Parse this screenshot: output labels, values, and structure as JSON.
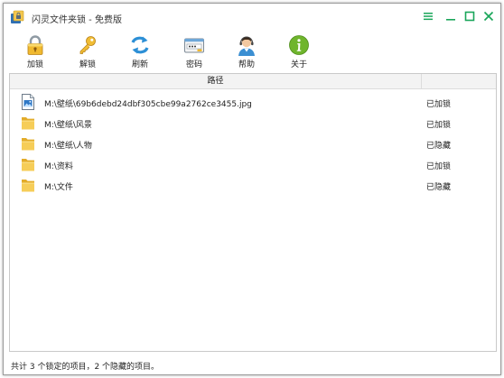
{
  "window": {
    "title": "闪灵文件夹锁 - 免费版",
    "colors": {
      "accent": "#1aa65a",
      "folder": "#f3c74e",
      "border": "#9a9a9a"
    }
  },
  "toolbar": {
    "items": [
      {
        "label": "加锁",
        "icon": "lock-icon"
      },
      {
        "label": "解锁",
        "icon": "key-icon"
      },
      {
        "label": "刷新",
        "icon": "refresh-icon"
      },
      {
        "label": "密码",
        "icon": "password-icon"
      },
      {
        "label": "帮助",
        "icon": "support-agent-icon"
      },
      {
        "label": "关于",
        "icon": "info-icon"
      }
    ]
  },
  "list": {
    "columns": {
      "path": "路径",
      "status": ""
    },
    "rows": [
      {
        "path": "M:\\壁纸\\69b6debd24dbf305cbe99a2762ce3455.jpg",
        "status": "已加锁",
        "icon": "image-file-icon"
      },
      {
        "path": "M:\\壁纸\\风景",
        "status": "已加锁",
        "icon": "folder-icon"
      },
      {
        "path": "M:\\壁纸\\人物",
        "status": "已隐藏",
        "icon": "folder-icon"
      },
      {
        "path": "M:\\资料",
        "status": "已加锁",
        "icon": "folder-icon"
      },
      {
        "path": "M:\\文件",
        "status": "已隐藏",
        "icon": "folder-icon"
      }
    ]
  },
  "statusbar": {
    "text": "共计 3 个锁定的项目，2 个隐藏的项目。"
  }
}
